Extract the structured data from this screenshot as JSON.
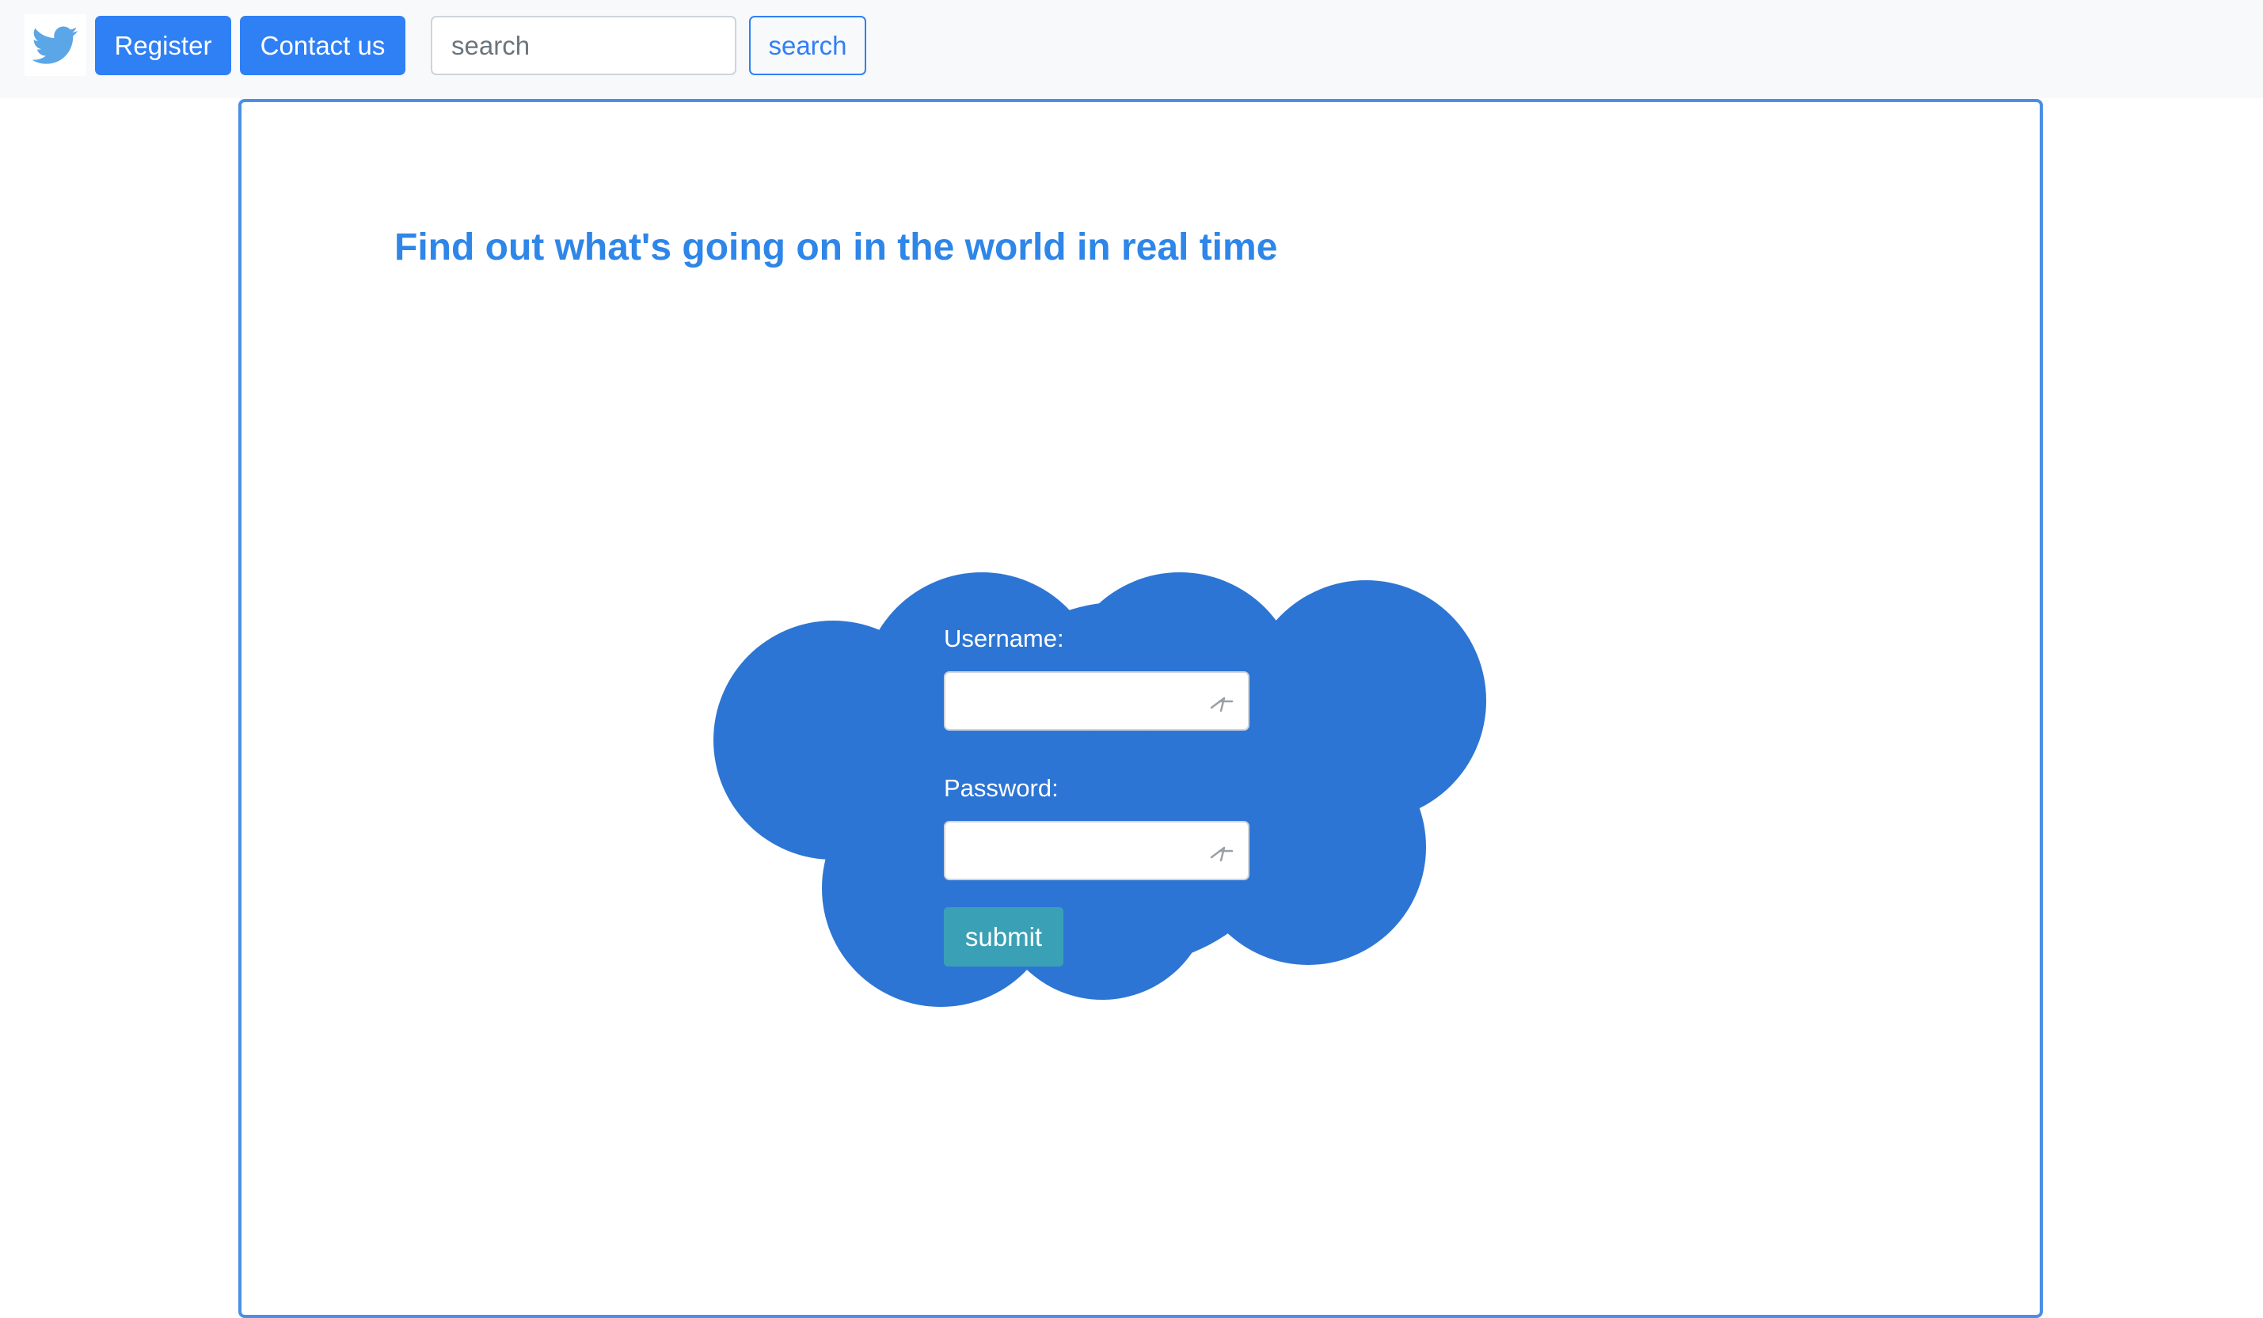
{
  "navbar": {
    "logo_icon": "twitter-bird-icon",
    "register_label": "Register",
    "contact_label": "Contact us",
    "search_placeholder": "search",
    "search_button_label": "search"
  },
  "main": {
    "tagline": "Find out what's going on in the world in real time"
  },
  "login": {
    "username_label": "Username:",
    "username_value": "",
    "password_label": "Password:",
    "password_value": "",
    "submit_label": "submit",
    "field_icon": "key-icon"
  },
  "colors": {
    "primary": "#2f80f5",
    "tagline": "#2e86e8",
    "cloud": "#2d75d4",
    "submit": "#3aa0b5",
    "card_border": "#4a8fe7",
    "navbar_bg": "#f8f9fa",
    "logo_bird": "#5aa6e6"
  }
}
